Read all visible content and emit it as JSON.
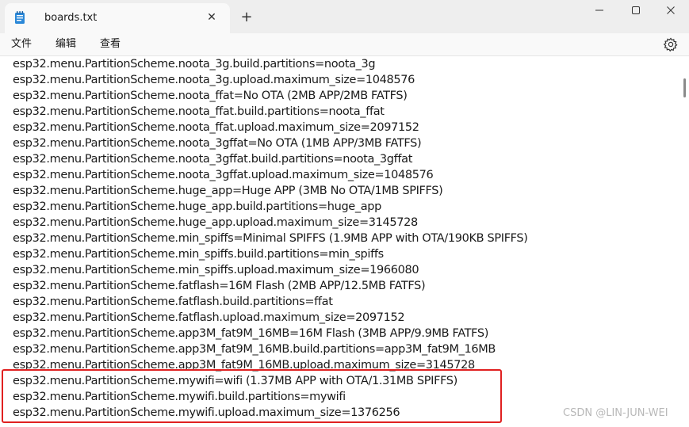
{
  "window": {
    "tab_title": "boards.txt",
    "tab_close_glyph": "✕",
    "new_tab_glyph": "+",
    "minimize_glyph": "—",
    "maximize_glyph": "☐",
    "close_glyph": "✕"
  },
  "menu": {
    "items": [
      "文件",
      "编辑",
      "查看"
    ],
    "settings_icon": "gear-icon"
  },
  "editor": {
    "lines": [
      "esp32.menu.PartitionScheme.noota_3g.build.partitions=noota_3g",
      "esp32.menu.PartitionScheme.noota_3g.upload.maximum_size=1048576",
      "esp32.menu.PartitionScheme.noota_ffat=No OTA (2MB APP/2MB FATFS)",
      "esp32.menu.PartitionScheme.noota_ffat.build.partitions=noota_ffat",
      "esp32.menu.PartitionScheme.noota_ffat.upload.maximum_size=2097152",
      "esp32.menu.PartitionScheme.noota_3gffat=No OTA (1MB APP/3MB FATFS)",
      "esp32.menu.PartitionScheme.noota_3gffat.build.partitions=noota_3gffat",
      "esp32.menu.PartitionScheme.noota_3gffat.upload.maximum_size=1048576",
      "esp32.menu.PartitionScheme.huge_app=Huge APP (3MB No OTA/1MB SPIFFS)",
      "esp32.menu.PartitionScheme.huge_app.build.partitions=huge_app",
      "esp32.menu.PartitionScheme.huge_app.upload.maximum_size=3145728",
      "esp32.menu.PartitionScheme.min_spiffs=Minimal SPIFFS (1.9MB APP with OTA/190KB SPIFFS)",
      "esp32.menu.PartitionScheme.min_spiffs.build.partitions=min_spiffs",
      "esp32.menu.PartitionScheme.min_spiffs.upload.maximum_size=1966080",
      "esp32.menu.PartitionScheme.fatflash=16M Flash (2MB APP/12.5MB FATFS)",
      "esp32.menu.PartitionScheme.fatflash.build.partitions=ffat",
      "esp32.menu.PartitionScheme.fatflash.upload.maximum_size=2097152",
      "esp32.menu.PartitionScheme.app3M_fat9M_16MB=16M Flash (3MB APP/9.9MB FATFS)",
      "esp32.menu.PartitionScheme.app3M_fat9M_16MB.build.partitions=app3M_fat9M_16MB",
      "esp32.menu.PartitionScheme.app3M_fat9M_16MB.upload.maximum_size=3145728",
      "esp32.menu.PartitionScheme.mywifi=wifi (1.37MB APP with OTA/1.31MB SPIFFS)",
      "esp32.menu.PartitionScheme.mywifi.build.partitions=mywifi",
      "esp32.menu.PartitionScheme.mywifi.upload.maximum_size=1376256"
    ],
    "highlight_color": "#e02020"
  },
  "watermark": "CSDN @LIN-JUN-WEI"
}
